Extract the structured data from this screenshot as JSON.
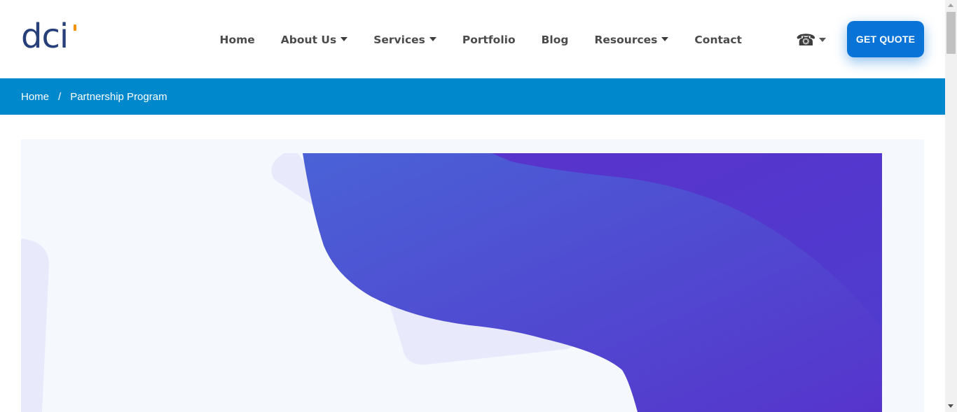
{
  "logo": {
    "text": "dci",
    "accent_color": "#f39200",
    "text_color": "#27407a"
  },
  "nav": {
    "items": [
      {
        "label": "Home",
        "dropdown": false
      },
      {
        "label": "About Us",
        "dropdown": true
      },
      {
        "label": "Services",
        "dropdown": true
      },
      {
        "label": "Portfolio",
        "dropdown": false
      },
      {
        "label": "Blog",
        "dropdown": false
      },
      {
        "label": "Resources",
        "dropdown": true
      },
      {
        "label": "Contact",
        "dropdown": false
      }
    ],
    "phone_icon": "phone-icon"
  },
  "cta": {
    "label": "GET QUOTE",
    "color": "#0a73d8"
  },
  "breadcrumb": {
    "home": "Home",
    "separator": "/",
    "current": "Partnership Program",
    "background": "#0088cc"
  },
  "hero": {
    "background": "#f5f9fd",
    "shape_light_color": "#e8eafc",
    "gradient_start": "#4a62d6",
    "gradient_end": "#5634cc"
  }
}
